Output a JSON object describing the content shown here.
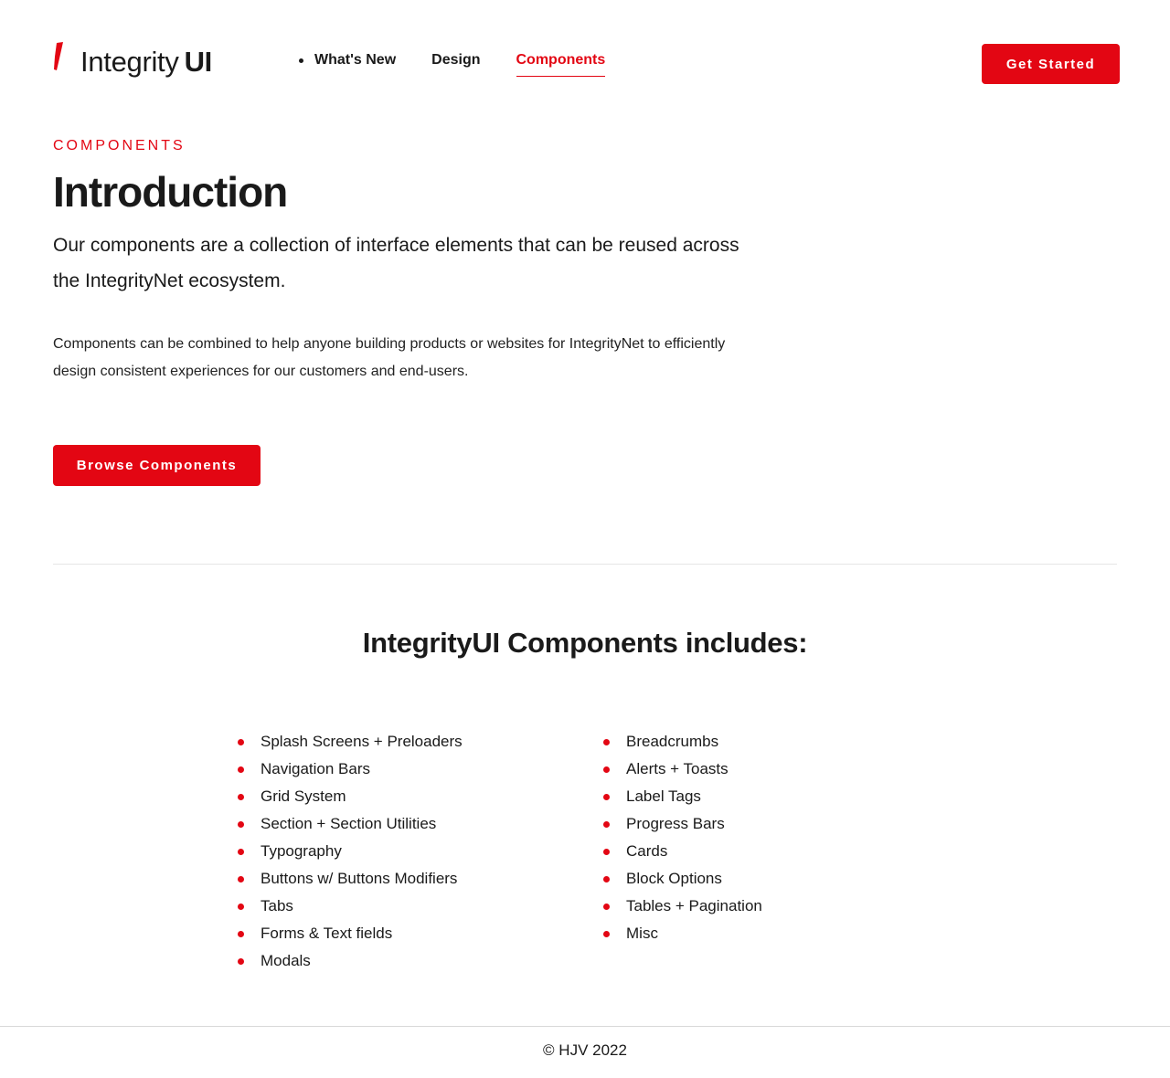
{
  "brand": {
    "name_light": "Integrity",
    "name_bold": "UI",
    "accent_color": "#e30613",
    "logo_icon": "red-slash-mark-icon"
  },
  "nav": {
    "items": [
      {
        "label": "What's New",
        "active": false
      },
      {
        "label": "Design",
        "active": false
      },
      {
        "label": "Components",
        "active": true
      }
    ]
  },
  "header": {
    "cta_label": "Get Started"
  },
  "intro": {
    "eyebrow": "COMPONENTS",
    "title": "Introduction",
    "lead": "Our components are a collection of interface elements that can be reused across the IntegrityNet ecosystem.",
    "body": "Components can be combined to help anyone building products or websites for IntegrityNet to efficiently design consistent experiences for our customers and end-users.",
    "browse_label": "Browse Components"
  },
  "includes": {
    "title": "IntegrityUI Components includes:",
    "left": [
      "Splash Screens + Preloaders",
      "Navigation Bars",
      "Grid System",
      "Section + Section Utilities",
      "Typography",
      "Buttons w/ Buttons Modifiers",
      "Tabs",
      "Forms & Text fields",
      "Modals"
    ],
    "right": [
      "Breadcrumbs",
      "Alerts + Toasts",
      "Label Tags",
      "Progress Bars",
      "Cards",
      "Block Options",
      "Tables + Pagination",
      "Misc"
    ]
  },
  "footer": {
    "copyright": "© HJV 2022"
  }
}
